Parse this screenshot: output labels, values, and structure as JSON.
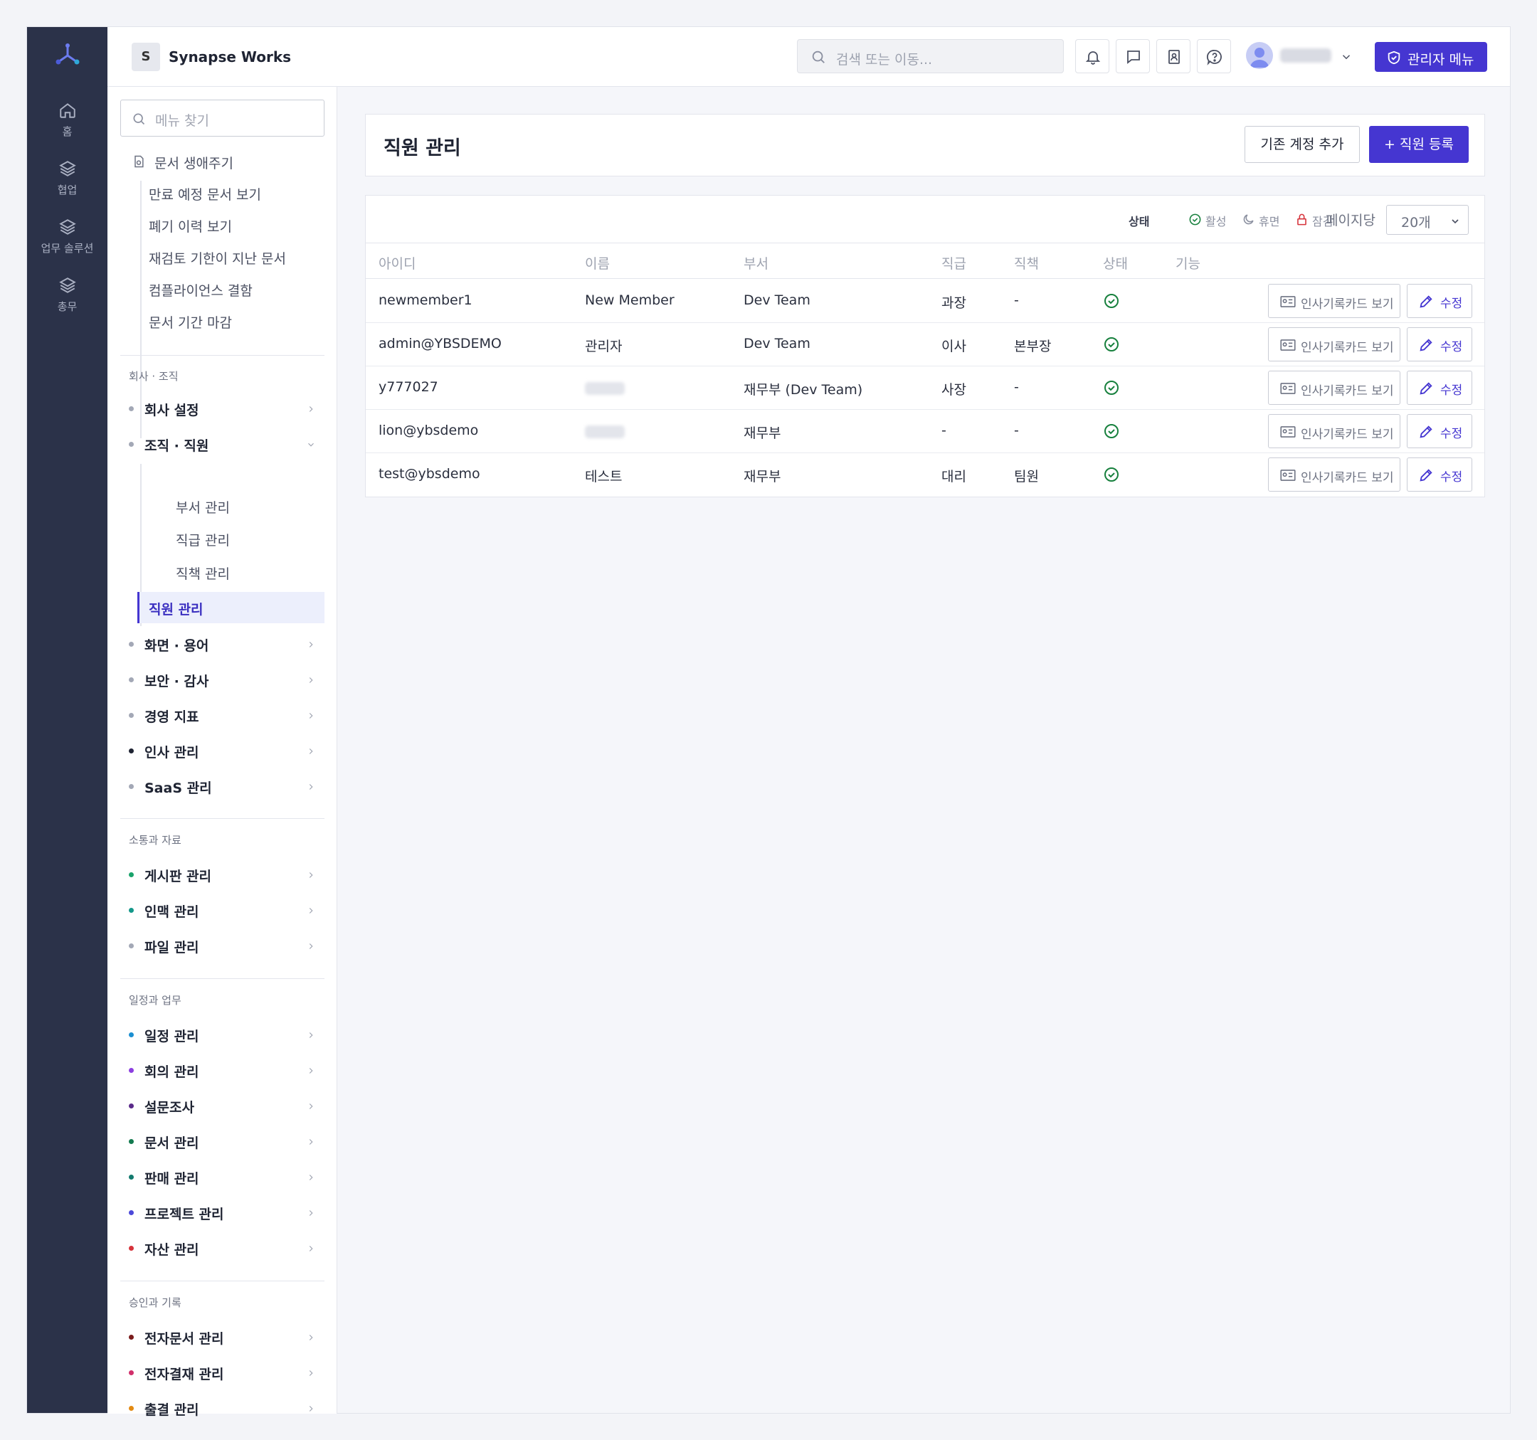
{
  "rail": {
    "items": [
      {
        "label": "홈",
        "icon": "home-icon"
      },
      {
        "label": "협업",
        "icon": "layers-icon"
      },
      {
        "label": "업무 솔루션",
        "icon": "layers-icon"
      },
      {
        "label": "총무",
        "icon": "layers-icon"
      }
    ]
  },
  "header": {
    "brand_badge": "S",
    "brand_name": "Synapse Works",
    "search_placeholder": "검색 또는 이동...",
    "admin_menu_label": "관리자 메뉴"
  },
  "sidebar": {
    "search_placeholder": "메뉴 찾기",
    "doc_lifecycle": {
      "label": "문서 생애주기",
      "items": [
        "만료 예정 문서 보기",
        "폐기 이력 보기",
        "재검토 기한이 지난 문서",
        "컴플라이언스 결함",
        "문서 기간 마감"
      ]
    },
    "groups": [
      {
        "label": "회사 · 조직",
        "items": [
          {
            "label": "회사 설정",
            "dot": "#a3a8b6"
          },
          {
            "label": "조직 · 직원",
            "dot": "#a3a8b6",
            "expanded": true,
            "children": [
              "부서 관리",
              "직급 관리",
              "직책 관리",
              "직원 관리"
            ]
          },
          {
            "label": "화면 · 용어",
            "dot": "#a3a8b6"
          },
          {
            "label": "보안 · 감사",
            "dot": "#a3a8b6"
          },
          {
            "label": "경영 지표",
            "dot": "#a3a8b6"
          },
          {
            "label": "인사 관리",
            "dot": "#1f2433"
          },
          {
            "label": "SaaS 관리",
            "dot": "#a3a8b6"
          }
        ]
      },
      {
        "label": "소통과 자료",
        "items": [
          {
            "label": "게시판 관리",
            "dot": "#1aa36b"
          },
          {
            "label": "인맥 관리",
            "dot": "#14988a"
          },
          {
            "label": "파일 관리",
            "dot": "#a3a8b6"
          }
        ]
      },
      {
        "label": "일정과 업무",
        "items": [
          {
            "label": "일정 관리",
            "dot": "#1b8fd1"
          },
          {
            "label": "회의 관리",
            "dot": "#8c3fe0"
          },
          {
            "label": "설문조사",
            "dot": "#5a2a8a"
          },
          {
            "label": "문서 관리",
            "dot": "#137a4f"
          },
          {
            "label": "판매 관리",
            "dot": "#137a6e"
          },
          {
            "label": "프로젝트 관리",
            "dot": "#4c49d9"
          },
          {
            "label": "자산 관리",
            "dot": "#d6333b"
          }
        ]
      },
      {
        "label": "승인과 기록",
        "items": [
          {
            "label": "전자문서 관리",
            "dot": "#7a1c1c"
          },
          {
            "label": "전자결재 관리",
            "dot": "#d1306b"
          },
          {
            "label": "출결 관리",
            "dot": "#e38a12"
          }
        ]
      }
    ]
  },
  "main": {
    "title": "직원 관리",
    "add_existing_label": "기존 계정 추가",
    "register_label": "+ 직원 등록",
    "toolbar": {
      "status_label": "상태",
      "legend_active": "활성",
      "legend_dormant": "휴면",
      "legend_locked": "잠김",
      "per_page_label": "페이지당",
      "per_page_value": "20개"
    },
    "columns": [
      "아이디",
      "이름",
      "부서",
      "직급",
      "직책",
      "상태",
      "기능"
    ],
    "rows": [
      {
        "id": "newmember1",
        "name": "New Member",
        "dept": "Dev Team",
        "rank": "과장",
        "position": "-",
        "status": "active"
      },
      {
        "id": "admin@YBSDEMO",
        "name": "관리자",
        "dept": "Dev Team",
        "rank": "이사",
        "position": "본부장",
        "status": "active"
      },
      {
        "id": "y777027",
        "name": "",
        "dept": "재무부 (Dev Team)",
        "rank": "사장",
        "position": "-",
        "status": "active"
      },
      {
        "id": "lion@ybsdemo",
        "name": "",
        "dept": "재무부",
        "rank": "-",
        "position": "-",
        "status": "active"
      },
      {
        "id": "test@ybsdemo",
        "name": "테스트",
        "dept": "재무부",
        "rank": "대리",
        "position": "팀원",
        "status": "active"
      }
    ],
    "action_card_label": "인사기록카드 보기",
    "action_edit_label": "수정"
  },
  "colors": {
    "accent": "#4536d1",
    "rail": "#2b3249",
    "status_active": "#17803d",
    "locked": "#d6333b"
  }
}
